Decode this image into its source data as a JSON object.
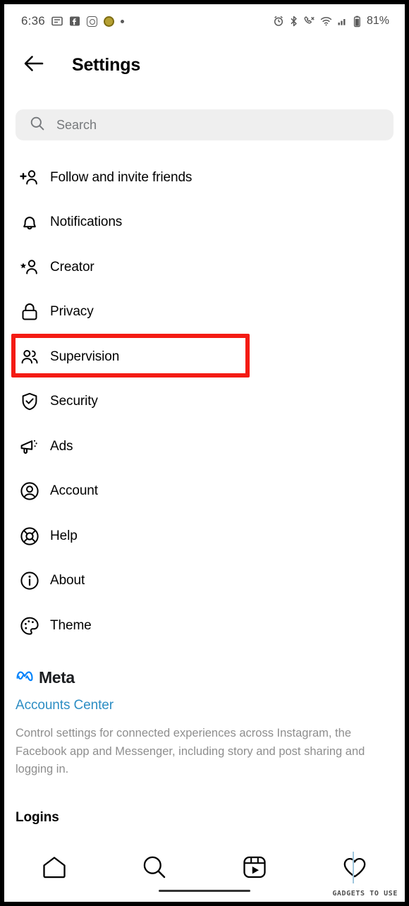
{
  "statusbar": {
    "time": "6:36",
    "battery_percent": "81%",
    "left_icons": [
      "news-icon",
      "facebook-messenger-icon",
      "instagram-icon",
      "coin-app-icon",
      "more-dot-icon"
    ],
    "right_icons": [
      "alarm-icon",
      "bluetooth-icon",
      "call-vibrate-icon",
      "wifi-icon",
      "cellular-signal-icon",
      "battery-icon"
    ]
  },
  "header": {
    "back_icon": "back-arrow-icon",
    "title": "Settings"
  },
  "search": {
    "placeholder": "Search",
    "icon": "search-icon"
  },
  "menu": {
    "items": [
      {
        "label": "Follow and invite friends",
        "icon": "person-add-icon"
      },
      {
        "label": "Notifications",
        "icon": "bell-icon"
      },
      {
        "label": "Creator",
        "icon": "person-star-icon"
      },
      {
        "label": "Privacy",
        "icon": "lock-icon"
      },
      {
        "label": "Supervision",
        "icon": "people-icon",
        "highlighted": true
      },
      {
        "label": "Security",
        "icon": "shield-check-icon"
      },
      {
        "label": "Ads",
        "icon": "megaphone-icon"
      },
      {
        "label": "Account",
        "icon": "person-circle-icon"
      },
      {
        "label": "Help",
        "icon": "lifebuoy-icon"
      },
      {
        "label": "About",
        "icon": "info-circle-icon"
      },
      {
        "label": "Theme",
        "icon": "palette-icon"
      }
    ]
  },
  "meta": {
    "logo_icon": "meta-infinity-icon",
    "brand": "Meta",
    "accounts_center_link": "Accounts Center",
    "description": "Control settings for connected experiences across Instagram, the Facebook app and Messenger, including story and post sharing and logging in.",
    "logins_heading": "Logins"
  },
  "bottomnav": {
    "items": [
      {
        "icon": "home-icon",
        "name": "nav-home"
      },
      {
        "icon": "search-icon",
        "name": "nav-search"
      },
      {
        "icon": "reels-icon",
        "name": "nav-reels"
      },
      {
        "icon": "heart-icon",
        "name": "nav-activity"
      }
    ]
  },
  "watermark": {
    "text": "GADGETS TO USE"
  },
  "colors": {
    "highlight_red": "#f41b14",
    "link_blue": "#2d8ec4",
    "meta_blue": "#0082fb",
    "search_bg": "#efefef",
    "muted_text": "#8e8e8e"
  }
}
